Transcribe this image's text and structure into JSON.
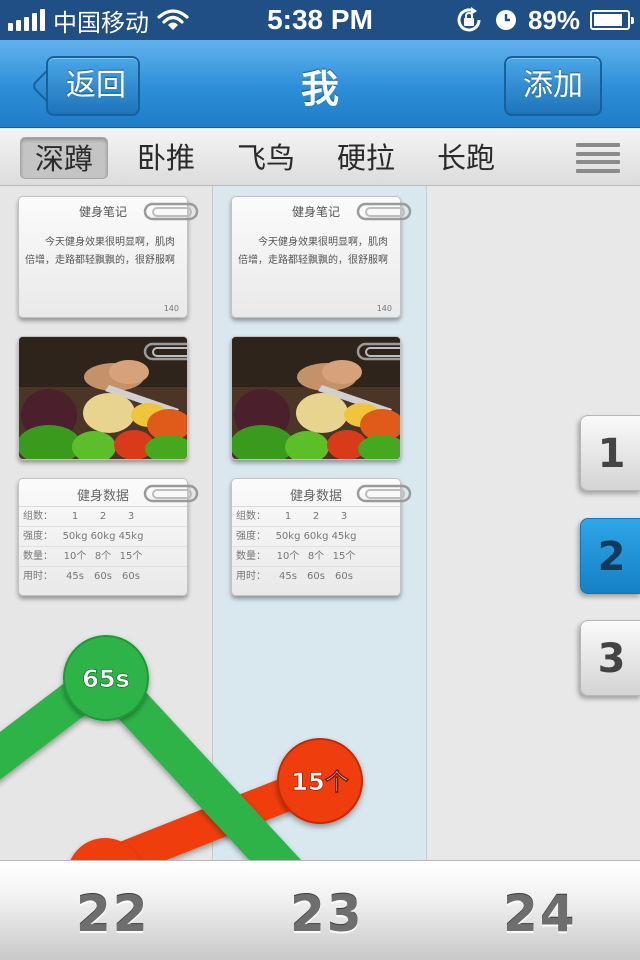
{
  "status_bar": {
    "carrier": "中国移动",
    "time": "5:38 PM",
    "battery": "89%",
    "battery_level": 0.89,
    "icons": [
      "signal-icon",
      "wifi-icon",
      "rotation-lock-icon",
      "alarm-icon",
      "battery-icon"
    ]
  },
  "nav": {
    "back_label": "返回",
    "title": "我",
    "add_label": "添加"
  },
  "tabs": [
    {
      "label": "深蹲",
      "active": true
    },
    {
      "label": "卧推",
      "active": false
    },
    {
      "label": "飞鸟",
      "active": false
    },
    {
      "label": "硬拉",
      "active": false
    },
    {
      "label": "长跑",
      "active": false
    }
  ],
  "columns": [
    {
      "note": {
        "title": "健身笔记",
        "text": "今天健身效果很明显啊，肌肉倍增，走路都轻飘飘的，很舒服啊",
        "count": "140"
      },
      "data": {
        "title": "健身数据",
        "rows": [
          {
            "label": "组数：",
            "values": [
              "1",
              "2",
              "3"
            ]
          },
          {
            "label": "强度：",
            "values": [
              "50kg",
              "60kg",
              "45kg"
            ]
          },
          {
            "label": "数量：",
            "values": [
              "10个",
              "8个",
              "15个"
            ]
          },
          {
            "label": "用时：",
            "values": [
              "45s",
              "60s",
              "60s"
            ]
          }
        ]
      }
    },
    {
      "note": {
        "title": "健身笔记",
        "text": "今天健身效果很明显啊，肌肉倍增，走路都轻飘飘的，很舒服啊",
        "count": "140"
      },
      "data": {
        "title": "健身数据",
        "rows": [
          {
            "label": "组数：",
            "values": [
              "1",
              "2",
              "3"
            ]
          },
          {
            "label": "强度：",
            "values": [
              "50kg",
              "60kg",
              "45kg"
            ]
          },
          {
            "label": "数量：",
            "values": [
              "10个",
              "8个",
              "15个"
            ]
          },
          {
            "label": "用时：",
            "values": [
              "45s",
              "60s",
              "60s"
            ]
          }
        ]
      }
    }
  ],
  "pager": [
    {
      "label": "1",
      "active": false
    },
    {
      "label": "2",
      "active": true
    },
    {
      "label": "3",
      "active": false
    }
  ],
  "graph": {
    "time_node": "65s",
    "count_node": "15个",
    "colors": {
      "time_line": "#2fb34a",
      "count_line": "#f03c10"
    }
  },
  "dates": [
    "22",
    "23",
    "24"
  ],
  "colors": {
    "nav_blue": "#2c8fd8",
    "active_pager": "#1e90d8",
    "column_highlight": "#d9e7ef"
  }
}
